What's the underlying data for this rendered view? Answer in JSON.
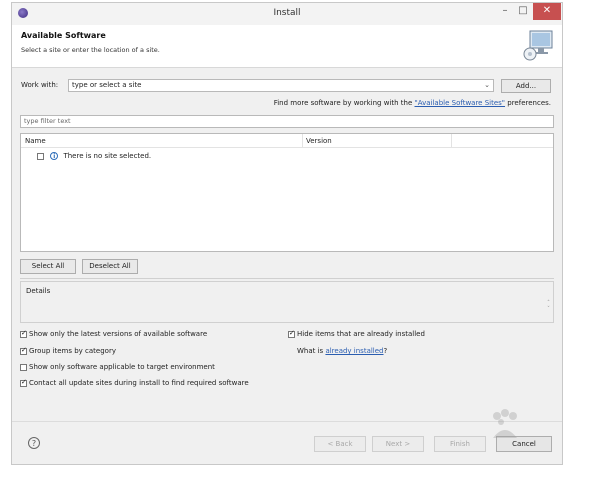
{
  "window": {
    "title": "Install"
  },
  "header": {
    "title": "Available Software",
    "description": "Select a site or enter the location of a site."
  },
  "work_with": {
    "label": "Work with:",
    "placeholder": "type or select a site",
    "add_label": "Add..."
  },
  "more_software": {
    "prefix": "Find more software by working with the ",
    "link": "\"Available Software Sites\"",
    "suffix": " preferences."
  },
  "filter": {
    "placeholder": "type filter text"
  },
  "tree": {
    "columns": [
      "Name",
      "Version"
    ],
    "rows": [
      {
        "label": "There is no site selected.",
        "checked": false
      }
    ]
  },
  "buttons": {
    "select_all": "Select All",
    "deselect_all": "Deselect All",
    "back": "< Back",
    "next": "Next >",
    "finish": "Finish",
    "cancel": "Cancel"
  },
  "details": {
    "label": "Details"
  },
  "options": {
    "latest_versions": {
      "label": "Show only the latest versions of available software",
      "checked": true
    },
    "group_by_category": {
      "label": "Group items by category",
      "checked": true
    },
    "target_env": {
      "label": "Show only software applicable to target environment",
      "checked": false
    },
    "contact_sites": {
      "label": "Contact all update sites during install to find required software",
      "checked": true
    },
    "hide_installed": {
      "label": "Hide items that are already installed",
      "checked": true
    },
    "what_is": {
      "prefix": "What is ",
      "link": "already installed",
      "suffix": "?"
    }
  },
  "icons": {
    "window": "eclipse-icon",
    "header": "install-monitor-icon",
    "help": "help-icon",
    "info": "info-icon"
  },
  "colors": {
    "link": "#2a5db0",
    "close_button": "#c75050"
  }
}
